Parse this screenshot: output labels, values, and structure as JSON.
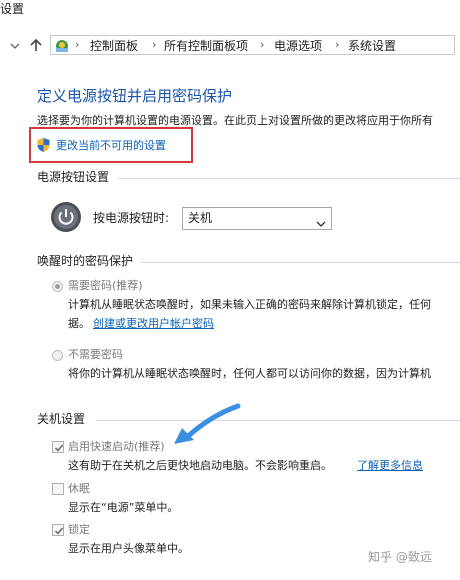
{
  "window": {
    "title": "设置"
  },
  "address_bar": {
    "crumbs": [
      "控制面板",
      "所有控制面板项",
      "电源选项",
      "系统设置"
    ]
  },
  "header": {
    "title": "定义电源按钮并启用密码保护",
    "description": "选择要为你的计算机设置的电源设置。在此页上对设置所做的更改将应用于你所有",
    "change_link": "更改当前不可用的设置"
  },
  "power_button": {
    "section_label": "电源按钮设置",
    "field_label": "按电源按钮时:",
    "selected_value": "关机"
  },
  "password_protection": {
    "section_label": "唤醒时的密码保护",
    "options": [
      {
        "label": "需要密码(推荐)",
        "selected": true,
        "desc_line1": "计算机从睡眠状态唤醒时，如果未输入正确的密码来解除计算机锁定，任何",
        "desc_line2_prefix": "据。",
        "desc_link": "创建或更改用户帐户密码"
      },
      {
        "label": "不需要密码",
        "selected": false,
        "desc_line1": "将你的计算机从睡眠状态唤醒时，任何人都可以访问你的数据，因为计算机"
      }
    ]
  },
  "shutdown": {
    "section_label": "关机设置",
    "items": [
      {
        "label": "启用快速启动(推荐)",
        "checked": true,
        "desc": "这有助于在关机之后更快地启动电脑。不会影响重启。",
        "link": "了解更多信息"
      },
      {
        "label": "休眠",
        "checked": false,
        "desc": "显示在“电源”菜单中。"
      },
      {
        "label": "锁定",
        "checked": true,
        "desc": "显示在用户头像菜单中。"
      }
    ]
  },
  "watermark": "知乎 @致远",
  "colors": {
    "title_blue": "#1a56a7",
    "link_blue": "#0b62b8",
    "highlight_red": "#d33b3b",
    "arrow_blue": "#3c8fe0"
  }
}
